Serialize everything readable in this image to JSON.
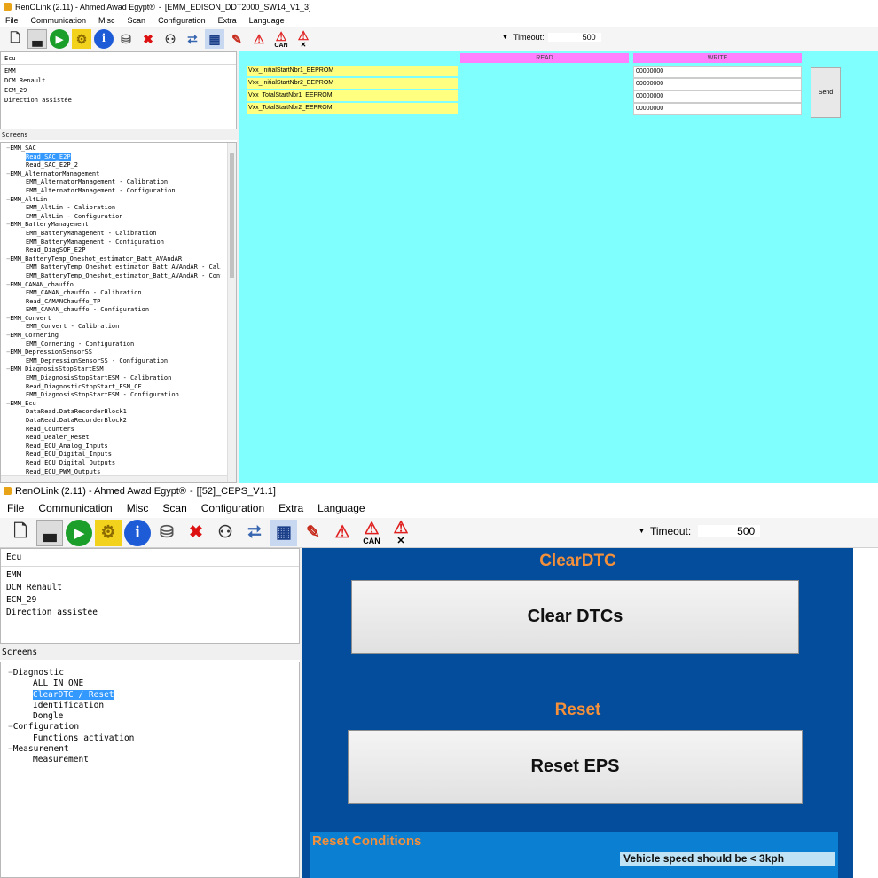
{
  "top_window": {
    "title": {
      "app": "RenOLink (2.11) - Ahmed Awad Egypt®",
      "separator": "-",
      "document": "[EMM_EDISON_DDT2000_SW14_V1_3]"
    },
    "menu": [
      "File",
      "Communication",
      "Misc",
      "Scan",
      "Configuration",
      "Extra",
      "Language"
    ],
    "toolbar": {
      "timeout_label": "Timeout:",
      "timeout_value": "500",
      "can_label": "CAN"
    },
    "ecu_panel": {
      "header": "Ecu",
      "lines": [
        "EMM",
        "DCM Renault",
        "ECM_29",
        "Direction assistée"
      ]
    },
    "screens_label": "Screens",
    "tree": [
      {
        "text": "EMM_SAC",
        "depth": 0
      },
      {
        "text": "Read_SAC_E2P",
        "depth": 1,
        "selected": true
      },
      {
        "text": "Read_SAC_E2P_2",
        "depth": 1
      },
      {
        "text": "EMM_AlternatorManagement",
        "depth": 0
      },
      {
        "text": "EMM_AlternatorManagement - Calibration",
        "depth": 1
      },
      {
        "text": "EMM_AlternatorManagement - Configuration",
        "depth": 1
      },
      {
        "text": "EMM_AltLin",
        "depth": 0
      },
      {
        "text": "EMM_AltLin - Calibration",
        "depth": 1
      },
      {
        "text": "EMM_AltLin - Configuration",
        "depth": 1
      },
      {
        "text": "EMM_BatteryManagement",
        "depth": 0
      },
      {
        "text": "EMM_BatteryManagement - Calibration",
        "depth": 1
      },
      {
        "text": "EMM_BatteryManagement - Configuration",
        "depth": 1
      },
      {
        "text": "Read_DiagSOF_E2P",
        "depth": 1
      },
      {
        "text": "EMM_BatteryTemp_Oneshot_estimator_Batt_AVAndAR",
        "depth": 0
      },
      {
        "text": "EMM_BatteryTemp_Oneshot_estimator_Batt_AVAndAR - Calib",
        "depth": 1
      },
      {
        "text": "EMM_BatteryTemp_Oneshot_estimator_Batt_AVAndAR - Confi",
        "depth": 1
      },
      {
        "text": "EMM_CAMAN_chauffo",
        "depth": 0
      },
      {
        "text": "EMM_CAMAN_chauffo - Calibration",
        "depth": 1
      },
      {
        "text": "Read_CAMANChauffo_TP",
        "depth": 1
      },
      {
        "text": "EMM_CAMAN_chauffo - Configuration",
        "depth": 1
      },
      {
        "text": "EMM_Convert",
        "depth": 0
      },
      {
        "text": "EMM_Convert - Calibration",
        "depth": 1
      },
      {
        "text": "EMM_Cornering",
        "depth": 0
      },
      {
        "text": "EMM_Cornering - Configuration",
        "depth": 1
      },
      {
        "text": "EMM_DepressionSensorSS",
        "depth": 0
      },
      {
        "text": "EMM_DepressionSensorSS - Configuration",
        "depth": 1
      },
      {
        "text": "EMM_DiagnosisStopStartESM",
        "depth": 0
      },
      {
        "text": "EMM_DiagnosisStopStartESM - Calibration",
        "depth": 1
      },
      {
        "text": "Read_DiagnosticStopStart_ESM_CF",
        "depth": 1
      },
      {
        "text": "EMM_DiagnosisStopStartESM - Configuration",
        "depth": 1
      },
      {
        "text": "EMM_Ecu",
        "depth": 0
      },
      {
        "text": "DataRead.DataRecorderBlock1",
        "depth": 1
      },
      {
        "text": "DataRead.DataRecorderBlock2",
        "depth": 1
      },
      {
        "text": "Read_Counters",
        "depth": 1
      },
      {
        "text": "Read_Dealer_Reset",
        "depth": 1
      },
      {
        "text": "Read_ECU_Analog_Inputs",
        "depth": 1
      },
      {
        "text": "Read_ECU_Digital_Inputs",
        "depth": 1
      },
      {
        "text": "Read_ECU_Digital_Outputs",
        "depth": 1
      },
      {
        "text": "Read_ECU_PWM_Outputs",
        "depth": 1
      }
    ],
    "rw_table": {
      "read_header": "READ",
      "write_header": "WRITE",
      "rows": [
        {
          "name": "Vxx_InitialStartNbr1_EEPROM",
          "read": "",
          "write": "00000000"
        },
        {
          "name": "Vxx_InitialStartNbr2_EEPROM",
          "read": "",
          "write": "00000000"
        },
        {
          "name": "Vxx_TotalStartNbr1_EEPROM",
          "read": "",
          "write": "00000000"
        },
        {
          "name": "Vxx_TotalStartNbr2_EEPROM",
          "read": "",
          "write": "00000000"
        }
      ],
      "send_label": "Send"
    }
  },
  "bottom_window": {
    "title": {
      "app": "RenOLink (2.11) - Ahmed Awad Egypt®",
      "separator": "-",
      "document": "[[52]_CEPS_V1.1]"
    },
    "menu": [
      "File",
      "Communication",
      "Misc",
      "Scan",
      "Configuration",
      "Extra",
      "Language"
    ],
    "toolbar": {
      "timeout_label": "Timeout:",
      "timeout_value": "500",
      "can_label": "CAN"
    },
    "ecu_panel": {
      "header": "Ecu",
      "lines": [
        "EMM",
        "DCM Renault",
        "ECM_29",
        "Direction assistée"
      ]
    },
    "screens_label": "Screens",
    "tree": [
      {
        "text": "Diagnostic",
        "depth": 0
      },
      {
        "text": "ALL IN ONE",
        "depth": 1
      },
      {
        "text": "ClearDTC / Reset",
        "depth": 1,
        "selected": true
      },
      {
        "text": "Identification",
        "depth": 1
      },
      {
        "text": "Dongle",
        "depth": 1
      },
      {
        "text": "Configuration",
        "depth": 0
      },
      {
        "text": "Functions activation",
        "depth": 1
      },
      {
        "text": "Measurement",
        "depth": 0
      },
      {
        "text": "Measurement",
        "depth": 1
      }
    ],
    "panel": {
      "clear_title": "ClearDTC",
      "clear_button": "Clear DTCs",
      "reset_title": "Reset",
      "reset_button": "Reset EPS",
      "conditions_title": "Reset Conditions",
      "condition_text": "Vehicle speed should be < 3kph"
    }
  },
  "colors": {
    "top_panel_bg": "#80ffff",
    "header_magenta": "#ff80ff",
    "name_yellow": "#ffff80",
    "bottom_panel_blue": "#034d9c",
    "accent_orange": "#f5903a",
    "selection_blue": "#3399ff"
  },
  "icons": [
    "new-file-icon",
    "signal-icon",
    "play-icon",
    "gear-icon",
    "info-icon",
    "database-icon",
    "close-icon",
    "binoculars-icon",
    "network-icon",
    "panel-icon",
    "pen-icon",
    "warning-icon",
    "can-warning-icon",
    "warning-clear-icon"
  ]
}
